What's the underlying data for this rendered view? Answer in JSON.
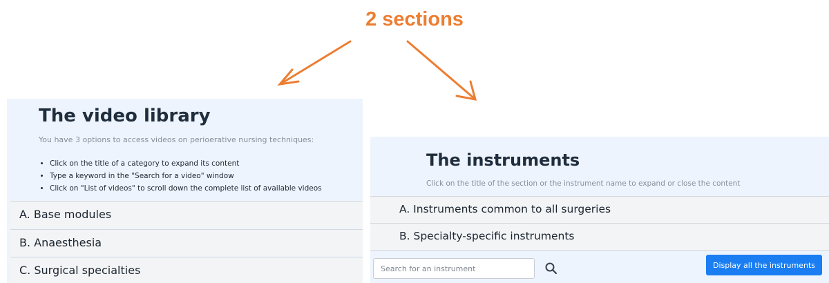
{
  "headline": "2 sections",
  "colors": {
    "headline": "#ED7D31",
    "panel_bg": "#eef4fd",
    "button_primary": "#1a7ef2"
  },
  "video_library": {
    "title": "The video library",
    "intro": "You have 3 options to access videos on perioerative nursing techniques:",
    "options": [
      "Click on the title of a category to expand its content",
      "Type a keyword in the \"Search for a video\" window",
      "Click on \"List of videos\" to scroll down the complete list of available videos"
    ],
    "categories": [
      "A. Base modules",
      "B. Anaesthesia",
      "C. Surgical specialties"
    ]
  },
  "instruments": {
    "title": "The instruments",
    "intro": "Click on the title of the section or the instrument name to expand or close the content",
    "sections": [
      "A. Instruments common to all surgeries",
      "B. Specialty-specific instruments"
    ],
    "search_placeholder": "Search for an instrument",
    "search_icon": "magnifier-icon",
    "display_all_label": "Display all the instruments"
  }
}
